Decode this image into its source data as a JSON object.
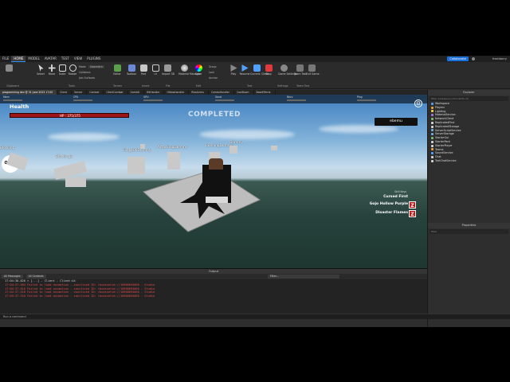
{
  "menubar": {
    "items": [
      "FILE",
      "HOME",
      "MODEL",
      "AVATAR",
      "TEST",
      "VIEW",
      "PLUGINS"
    ],
    "active_index": 1,
    "collaborate_label": "Collaborate",
    "username": "freshberry"
  },
  "ribbon": {
    "tools": [
      "Select",
      "Move",
      "Scale",
      "Rotate"
    ],
    "mode_label": "Mode:",
    "mode_value": "Geometric",
    "collisions_label": "Collisions",
    "join_surfaces_label": "Join Surfaces",
    "insert_buttons": [
      "Editor",
      "Toolbox",
      "Part",
      "UI",
      "Import 3D"
    ],
    "material_buttons": [
      "Material Manager",
      "Color"
    ],
    "group_label": "Group",
    "lock_label": "Lock",
    "anchor_label": "Anchor",
    "test_buttons": [
      "Play",
      "Resume",
      "Current: Client",
      "Stop"
    ],
    "settings_buttons": [
      "Game Settings"
    ],
    "team_test_buttons": [
      "Team Test",
      "Exit Game"
    ],
    "group_labels": [
      "Clipboard",
      "Tools",
      "Terrain",
      "Insert",
      "File",
      "Edit",
      "Test",
      "Settings",
      "Team Test"
    ]
  },
  "tabs": [
    "programming dev @ 31 June 2023 17:00",
    "Client",
    "Server",
    "Combat",
    "ClientCombat",
    "Gambit",
    "HitHandler",
    "Hitboxhandler",
    "RbxAnims",
    "ComboHandler",
    "CoolDown",
    "BaseEffects"
  ],
  "viewport": {
    "stats": [
      "Mem",
      "CPU",
      "GPU",
      "Send",
      "Recv",
      "Ping"
    ],
    "health_label": "Health",
    "hp_text": "HP : 375/375",
    "hp_fraction": 1.0,
    "completed_text": "COMPLETED",
    "player_name": "ebemu",
    "open_label": "OPEN",
    "npc_labels": [
      "Blocking",
      "Blocking2",
      "Fling100Dummy",
      "AttackingDummy",
      "RunningDummy",
      "Dummy"
    ],
    "skill_keys_label": "Skill Keys",
    "skills": [
      {
        "name": "Cursed First",
        "key": ""
      },
      {
        "name": "Gojo Hollow Purple",
        "key": "Z"
      },
      {
        "name": "Disaster Flames",
        "key": "Z"
      }
    ]
  },
  "explorer": {
    "title": "Explorer",
    "filter_placeholder": "Filter workspace (Ctrl+Shift+X)",
    "items": [
      "Workspace",
      "Players",
      "Lighting",
      "MaterialService",
      "NetworkClient",
      "ReplicatedFirst",
      "ReplicatedStorage",
      "ServerScriptService",
      "ServerStorage",
      "StarterGui",
      "StarterPack",
      "StarterPlayer",
      "Teams",
      "SoundService",
      "Chat",
      "TextChatService"
    ]
  },
  "properties": {
    "title": "Properties",
    "filter_placeholder": "Filter"
  },
  "output": {
    "title": "Output",
    "filter_all_messages": "All Messages",
    "filter_all_contexts": "All Contexts",
    "filter_placeholder": "Filter...",
    "lines": [
      {
        "text": "17:04:30.826  > [...] - Client - Client:44",
        "color": "#cfcfcf"
      },
      {
        "text": "17:04:37.004  Failed to load animation - sanitized ID: rbxassetid://10980694066  -  Studio",
        "color": "#e04a4a"
      },
      {
        "text": "17:04:37.016  Failed to load animation - sanitized ID: rbxassetid://10980694066  -  Studio",
        "color": "#e04a4a"
      },
      {
        "text": "17:04:37.516  Failed to load animation - sanitized ID: rbxassetid://10980694066  -  Studio",
        "color": "#e04a4a"
      },
      {
        "text": "17:04:37.516  Failed to load animation - sanitized ID: rbxassetid://10980694066  -  Studio",
        "color": "#e04a4a"
      }
    ]
  },
  "command_bar": {
    "placeholder": "Run a command"
  }
}
